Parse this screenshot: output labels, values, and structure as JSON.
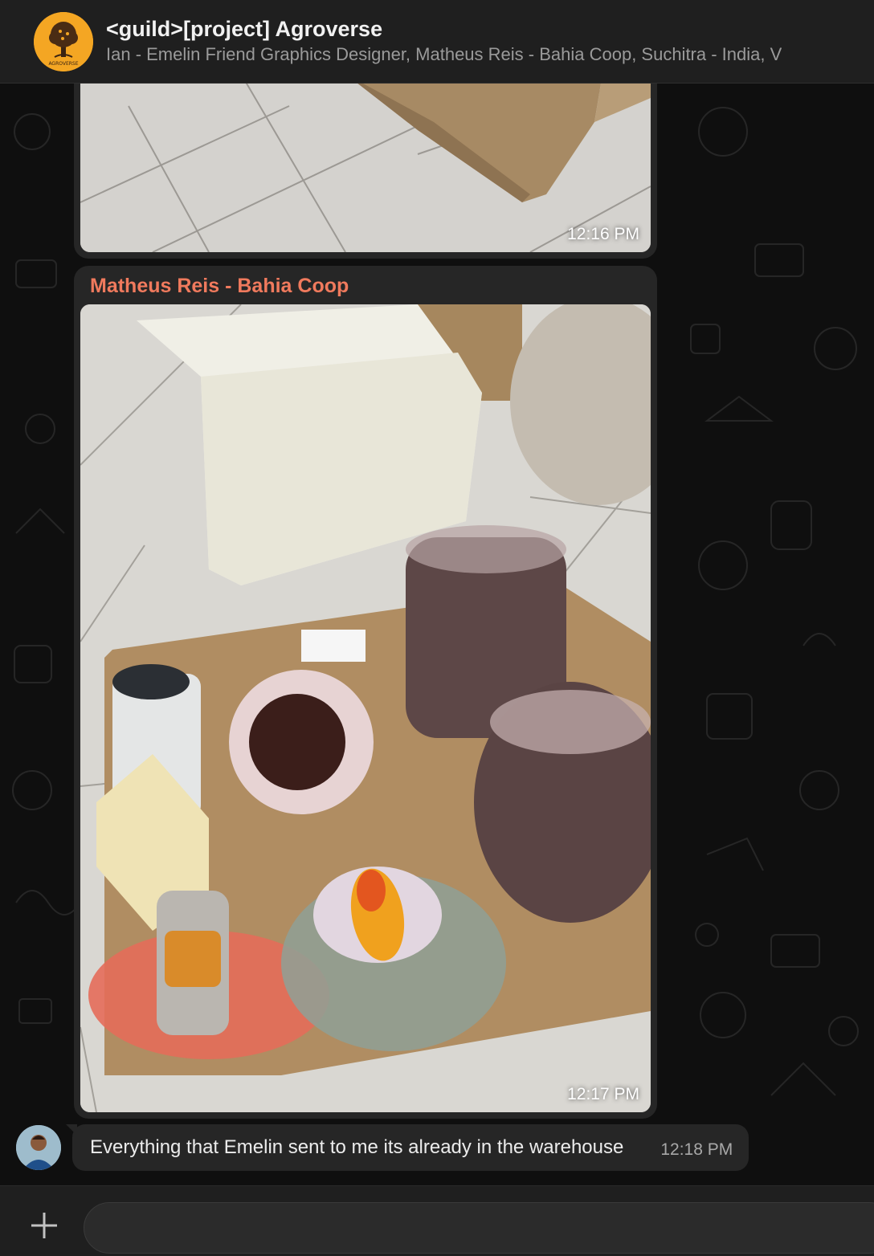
{
  "header": {
    "title": "<guild>[project] Agroverse",
    "members": "Ian - Emelin Friend Graphics Designer, Matheus Reis - Bahia Coop, Suchitra - India, V",
    "avatar_icon": "agroverse-logo",
    "avatar_label": "AGROVERSE"
  },
  "messages": [
    {
      "type": "photo",
      "time": "12:16 PM"
    },
    {
      "type": "photo",
      "sender": "Matheus Reis - Bahia Coop",
      "time": "12:17 PM"
    },
    {
      "type": "text",
      "text": "Everything that Emelin sent to me its already in the warehouse",
      "time": "12:18 PM",
      "avatar_icon": "user-avatar"
    }
  ],
  "composer": {
    "attach_icon": "plus-icon",
    "placeholder": ""
  },
  "colors": {
    "background": "#0f0f0f",
    "bubble": "#262626",
    "sender_name": "#f07a5d",
    "header": "#1f1f1f"
  }
}
